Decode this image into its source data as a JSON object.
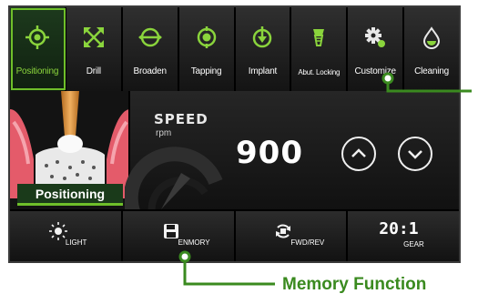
{
  "modes": [
    {
      "key": "positioning",
      "label": "Positioning",
      "active": true,
      "icon": "target-icon"
    },
    {
      "key": "drill",
      "label": "Drill",
      "active": false,
      "icon": "expand-arrows-icon"
    },
    {
      "key": "broaden",
      "label": "Broaden",
      "active": false,
      "icon": "broaden-icon"
    },
    {
      "key": "tapping",
      "label": "Tapping",
      "active": false,
      "icon": "tapping-icon"
    },
    {
      "key": "implant",
      "label": "Implant",
      "active": false,
      "icon": "implant-icon"
    },
    {
      "key": "abut_locking",
      "label": "Abut. Locking",
      "active": false,
      "icon": "abutment-icon"
    },
    {
      "key": "customize",
      "label": "Customize",
      "active": false,
      "icon": "gear-icon"
    },
    {
      "key": "cleaning",
      "label": "Cleaning",
      "active": false,
      "icon": "droplet-icon"
    }
  ],
  "status": {
    "label": "Positioning"
  },
  "speed": {
    "title": "SPEED",
    "unit": "rpm",
    "value": "900"
  },
  "bottom": {
    "light_label": "LIGHT",
    "memory_label": "ENMORY",
    "direction_label": "FWD/REV",
    "gear_ratio": "20:1",
    "gear_label": "GEAR"
  },
  "callouts": {
    "memory_function": "Memory Function"
  },
  "colors": {
    "accent": "#6fbf2a",
    "callout": "#3a8a1f",
    "screen_bg": "#0b0b0b",
    "gum": "#e45b6a"
  }
}
